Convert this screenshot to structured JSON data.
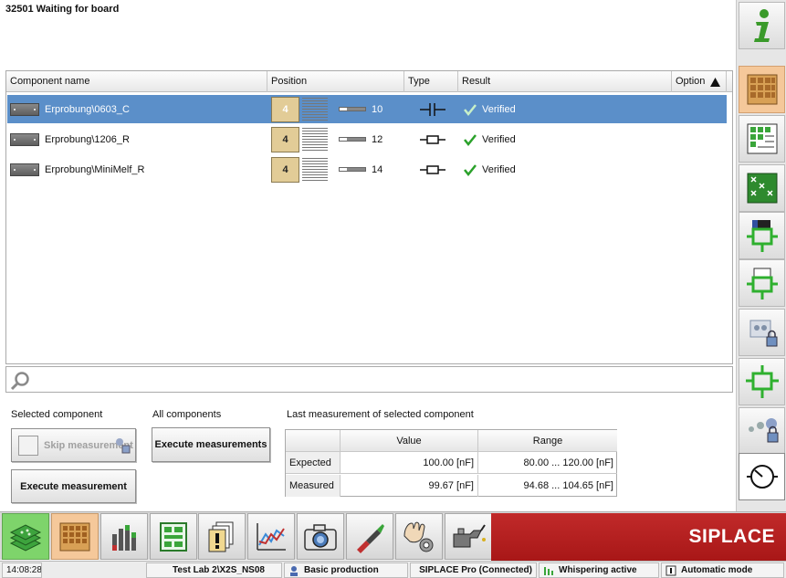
{
  "title": "32501 Waiting for board",
  "table": {
    "headers": {
      "component": "Component name",
      "position": "Position",
      "type": "Type",
      "result": "Result",
      "option": "Option"
    },
    "rows": [
      {
        "name": "Erprobung\\0603_C",
        "pos": "4",
        "track": "10",
        "type": "capacitor",
        "result": "Verified",
        "selected": true
      },
      {
        "name": "Erprobung\\1206_R",
        "pos": "4",
        "track": "12",
        "type": "resistor",
        "result": "Verified",
        "selected": false
      },
      {
        "name": "Erprobung\\MiniMelf_R",
        "pos": "4",
        "track": "14",
        "type": "resistor",
        "result": "Verified",
        "selected": false
      }
    ]
  },
  "search": {
    "value": "",
    "placeholder": ""
  },
  "selected_component": {
    "label": "Selected component",
    "skip_label": "Skip measurement",
    "execute_label": "Execute measurement"
  },
  "all_components": {
    "label": "All components",
    "execute_label": "Execute measurements"
  },
  "last_measurement": {
    "label": "Last measurement of selected component",
    "value_header": "Value",
    "range_header": "Range",
    "rows": [
      {
        "label": "Expected",
        "value": "100.00 [nF]",
        "range": "80.00 ... 120.00 [nF]"
      },
      {
        "label": "Measured",
        "value": "99.67 [nF]",
        "range": "94.68 ... 104.65 [nF]"
      }
    ]
  },
  "brand": "SIPLACE",
  "status": {
    "time": "14:08:28",
    "location": "Test Lab 2\\X2S_NS08",
    "mode": "Basic production",
    "connection": "SIPLACE Pro (Connected)",
    "whisper": "Whispering active",
    "auto": "Automatic mode"
  },
  "colors": {
    "selection": "#5b8fc9",
    "active_tab": "#f5c89a",
    "brand_red": "#b31f1f",
    "check_green": "#2aa12a",
    "nav_green": "#7ed46b"
  }
}
